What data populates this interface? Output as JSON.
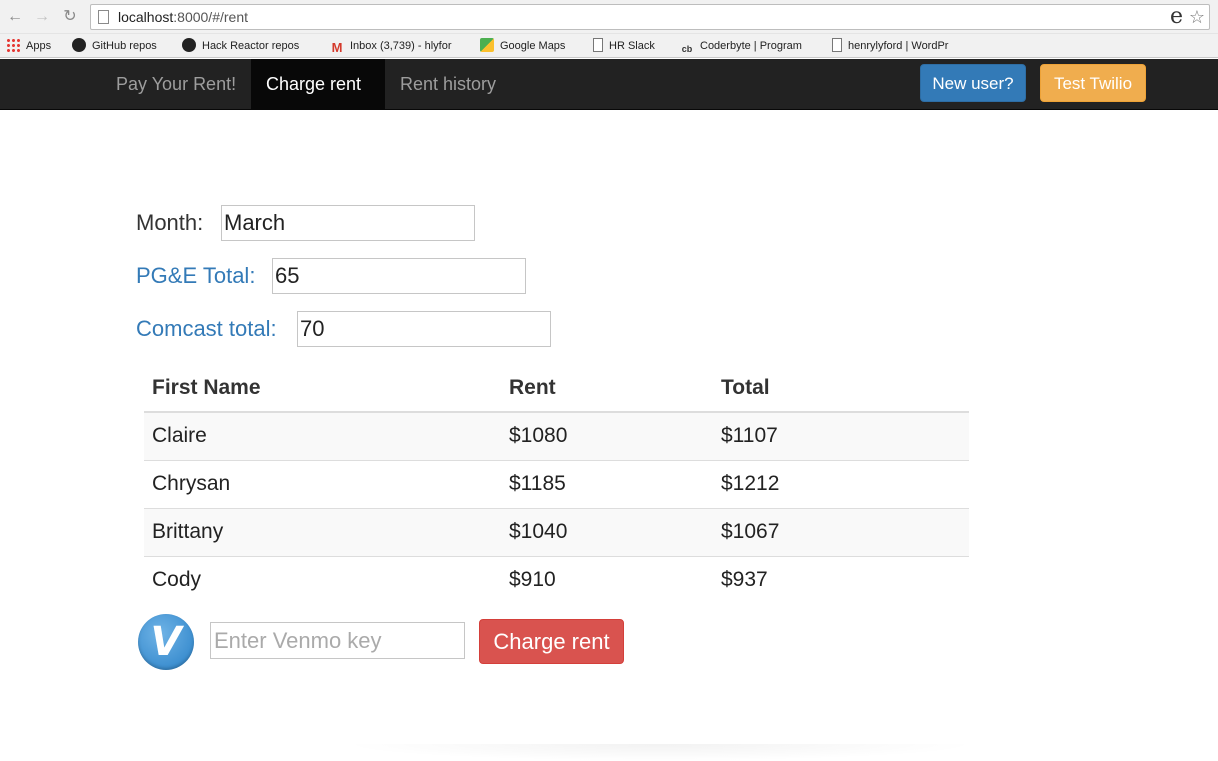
{
  "browser": {
    "url_host": "localhost",
    "url_path": ":8000/#/rent",
    "bookmarks": [
      {
        "label": "Apps",
        "icon": "apps-grid-icon"
      },
      {
        "label": "GitHub repos",
        "icon": "github-icon"
      },
      {
        "label": "Hack Reactor repos",
        "icon": "github-icon"
      },
      {
        "label": "Inbox (3,739) - hlyfor",
        "icon": "gmail-icon"
      },
      {
        "label": "Google Maps",
        "icon": "maps-icon"
      },
      {
        "label": "HR Slack",
        "icon": "page-icon"
      },
      {
        "label": "Coderbyte | Program",
        "icon": "coderbyte-icon"
      },
      {
        "label": "henrylyford | WordPr",
        "icon": "page-icon"
      }
    ]
  },
  "navbar": {
    "brand": "Pay Your Rent!",
    "charge_rent": "Charge rent",
    "rent_history": "Rent history",
    "new_user": "New user?",
    "test_twilio": "Test Twilio"
  },
  "form": {
    "month_label": "Month:",
    "month_value": "March",
    "pge_label": "PG&E Total:",
    "pge_value": "65",
    "comcast_label": "Comcast total:",
    "comcast_value": "70"
  },
  "table": {
    "headers": [
      "First Name",
      "Rent",
      "Total"
    ],
    "rows": [
      [
        "Claire",
        "$1080",
        "$1107"
      ],
      [
        "Chrysan",
        "$1185",
        "$1212"
      ],
      [
        "Brittany",
        "$1040",
        "$1067"
      ],
      [
        "Cody",
        "$910",
        "$937"
      ]
    ]
  },
  "venmo": {
    "logo_letter": "V",
    "key_placeholder": "Enter Venmo key",
    "charge_button": "Charge rent"
  },
  "colors": {
    "navbar_bg": "#222222",
    "primary": "#337ab7",
    "warning": "#f0ad4e",
    "danger": "#d9534f",
    "venmo_blue": "#3d8fd0"
  }
}
